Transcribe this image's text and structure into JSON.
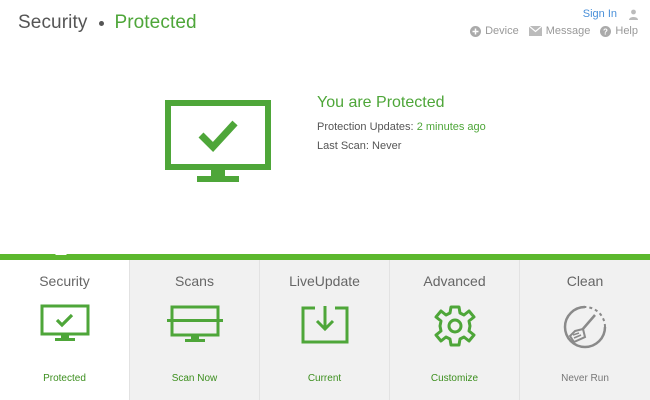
{
  "header": {
    "title": "Security",
    "status": "Protected"
  },
  "top_right": {
    "sign_in": "Sign In",
    "menu": [
      {
        "label": "Device",
        "icon": "plus-circle-icon"
      },
      {
        "label": "Message",
        "icon": "envelope-icon"
      },
      {
        "label": "Help",
        "icon": "question-circle-icon"
      }
    ]
  },
  "hero": {
    "title": "You are Protected",
    "updates_label": "Protection Updates:",
    "updates_value": "2 minutes ago",
    "scan_label": "Last Scan:",
    "scan_value": "Never",
    "icon": "monitor-check-icon"
  },
  "tabs": [
    {
      "title": "Security",
      "action": "Protected",
      "icon": "monitor-check-icon",
      "active": true
    },
    {
      "title": "Scans",
      "action": "Scan Now",
      "icon": "monitor-scan-icon",
      "active": false
    },
    {
      "title": "LiveUpdate",
      "action": "Current",
      "icon": "download-box-icon",
      "active": false
    },
    {
      "title": "Advanced",
      "action": "Customize",
      "icon": "gear-icon",
      "active": false
    },
    {
      "title": "Clean",
      "action": "Never Run",
      "icon": "broom-clock-icon",
      "active": false
    }
  ],
  "colors": {
    "brand_green": "#4ea639",
    "bar_green": "#5cb82e",
    "link_blue": "#4a90d9"
  }
}
